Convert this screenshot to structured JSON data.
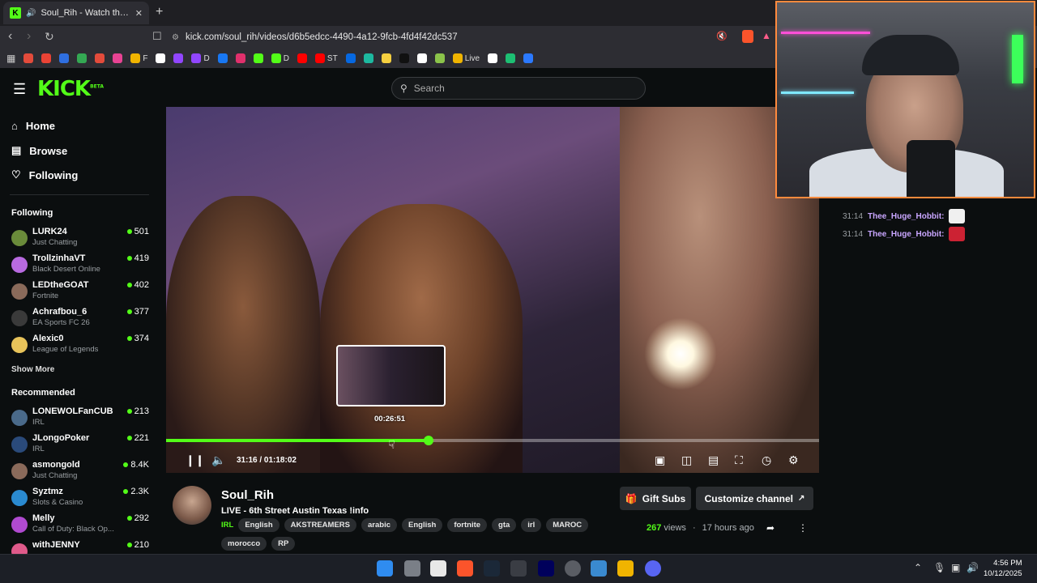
{
  "browser": {
    "tab_title": "Soul_Rih - Watch the VOD on Kick",
    "new_tab_icon": "+",
    "url": "kick.com/soul_rih/videos/d6b5edcc-4490-4a12-9fcb-4fd4f42dc537",
    "bookmarks": [
      {
        "label": "",
        "color": "#e34b3b"
      },
      {
        "label": "",
        "color": "#ea4335"
      },
      {
        "label": "",
        "color": "#2f6fe0"
      },
      {
        "label": "",
        "color": "#34a853"
      },
      {
        "label": "",
        "color": "#e34b3b"
      },
      {
        "label": "",
        "color": "#e84393"
      },
      {
        "label": "F",
        "color": "#f0b400"
      },
      {
        "label": "",
        "color": "#ffffff"
      },
      {
        "label": "",
        "color": "#9146ff"
      },
      {
        "label": "D",
        "color": "#9146ff"
      },
      {
        "label": "",
        "color": "#1877f2"
      },
      {
        "label": "",
        "color": "#e1306c"
      },
      {
        "label": "",
        "color": "#53fc18"
      },
      {
        "label": "D",
        "color": "#53fc18"
      },
      {
        "label": "",
        "color": "#ff0000"
      },
      {
        "label": "ST",
        "color": "#ff0000"
      },
      {
        "label": "",
        "color": "#0668e1"
      },
      {
        "label": "",
        "color": "#1db9a0"
      },
      {
        "label": "",
        "color": "#f6d040"
      },
      {
        "label": "",
        "color": "#111111"
      },
      {
        "label": "",
        "color": "#ffffff"
      },
      {
        "label": "",
        "color": "#8bc34a"
      },
      {
        "label": "Live",
        "color": "#f0b400"
      },
      {
        "label": "",
        "color": "#ffffff"
      },
      {
        "label": "",
        "color": "#1dbf73"
      },
      {
        "label": "",
        "color": "#2b79ff"
      }
    ]
  },
  "header": {
    "logo": "KICK",
    "logo_badge": "BETA",
    "search_placeholder": "Search"
  },
  "sidebar": {
    "nav": [
      {
        "label": "Home",
        "icon": "home-icon"
      },
      {
        "label": "Browse",
        "icon": "browse-icon"
      },
      {
        "label": "Following",
        "icon": "heart-icon"
      }
    ],
    "following_title": "Following",
    "following": [
      {
        "name": "LURK24",
        "category": "Just Chatting",
        "viewers": "501",
        "color": "#6a8b3a"
      },
      {
        "name": "TrollzinhaVT",
        "category": "Black Desert Online",
        "viewers": "419",
        "color": "#b86ae0"
      },
      {
        "name": "LEDtheGOAT",
        "category": "Fortnite",
        "viewers": "402",
        "color": "#8a6a5a"
      },
      {
        "name": "Achrafbou_6",
        "category": "EA Sports FC 26",
        "viewers": "377",
        "color": "#3a3a3a"
      },
      {
        "name": "Alexic0",
        "category": "League of Legends",
        "viewers": "374",
        "color": "#e8c35a"
      }
    ],
    "show_more": "Show More",
    "recommended_title": "Recommended",
    "recommended": [
      {
        "name": "LONEWOLFanCUB",
        "category": "IRL",
        "viewers": "213",
        "color": "#4a6a8a"
      },
      {
        "name": "JLongoPoker",
        "category": "IRL",
        "viewers": "221",
        "color": "#2a4a7a"
      },
      {
        "name": "asmongold",
        "category": "Just Chatting",
        "viewers": "8.4K",
        "color": "#8a6a5a"
      },
      {
        "name": "Syztmz",
        "category": "Slots & Casino",
        "viewers": "2.3K",
        "color": "#2a8ad0"
      },
      {
        "name": "Melly",
        "category": "Call of Duty: Black Op...",
        "viewers": "292",
        "color": "#b04ad0"
      },
      {
        "name": "withJENNY",
        "category": "",
        "viewers": "210",
        "color": "#e05a8a"
      }
    ]
  },
  "player": {
    "preview_time": "00:26:51",
    "time_label": "31:16 / 01:18:02",
    "progress": 0.402
  },
  "chat": {
    "messages": [
      {
        "time": "31:14",
        "user": "Thee_Huge_Hobbit:"
      },
      {
        "time": "31:14",
        "user": "Thee_Huge_Hobbit:"
      }
    ]
  },
  "channel": {
    "name": "Soul_Rih",
    "title": "LIVE - 6th Street Austin Texas !info",
    "category": "IRL",
    "tags": [
      "English",
      "AKSTREAMERS",
      "arabic",
      "English",
      "fortnite",
      "gta",
      "irl",
      "MAROC",
      "morocco",
      "RP"
    ],
    "gift_label": "Gift Subs",
    "customize_label": "Customize channel",
    "views_count": "267",
    "views_label": "views",
    "age": "17 hours ago"
  },
  "taskbar": {
    "time": "4:56 PM",
    "date": "10/12/2025"
  },
  "colors": {
    "accent": "#53fc18",
    "chat_username": "#c9a6ff",
    "webcam_border": "#ff8a3d"
  }
}
